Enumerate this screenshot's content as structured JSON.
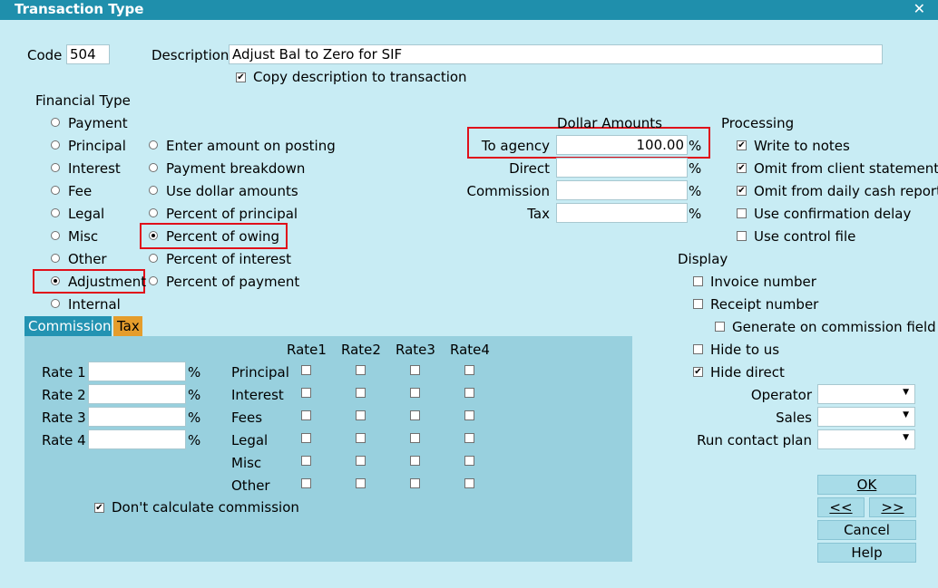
{
  "window": {
    "title": "Transaction Type",
    "close_glyph": "✕"
  },
  "code": {
    "label": "Code",
    "value": "504"
  },
  "description": {
    "label": "Description",
    "value": "Adjust Bal to Zero for SIF"
  },
  "copy_description": {
    "label": "Copy description to transaction",
    "checked": true
  },
  "financial_type": {
    "label": "Financial Type",
    "col1": [
      {
        "label": "Payment",
        "selected": false
      },
      {
        "label": "Principal",
        "selected": false
      },
      {
        "label": "Interest",
        "selected": false
      },
      {
        "label": "Fee",
        "selected": false
      },
      {
        "label": "Legal",
        "selected": false
      },
      {
        "label": "Misc",
        "selected": false
      },
      {
        "label": "Other",
        "selected": false
      },
      {
        "label": "Adjustment",
        "selected": true
      },
      {
        "label": "Internal",
        "selected": false
      }
    ],
    "col2": [
      {
        "label": "Enter amount on posting",
        "selected": false
      },
      {
        "label": "Payment breakdown",
        "selected": false
      },
      {
        "label": "Use dollar amounts",
        "selected": false
      },
      {
        "label": "Percent of principal",
        "selected": false
      },
      {
        "label": "Percent of owing",
        "selected": true
      },
      {
        "label": "Percent of interest",
        "selected": false
      },
      {
        "label": "Percent of payment",
        "selected": false
      }
    ]
  },
  "dollar_amounts": {
    "label": "Dollar Amounts",
    "rows": [
      {
        "label": "To agency",
        "value": "100.00",
        "unit": "%"
      },
      {
        "label": "Direct",
        "value": "",
        "unit": "%"
      },
      {
        "label": "Commission",
        "value": "",
        "unit": "%"
      },
      {
        "label": "Tax",
        "value": "",
        "unit": "%"
      }
    ]
  },
  "processing": {
    "label": "Processing",
    "items": [
      {
        "label": "Write to notes",
        "checked": true
      },
      {
        "label": "Omit from client statement",
        "checked": true
      },
      {
        "label": "Omit from daily cash report",
        "checked": true
      },
      {
        "label": "Use confirmation delay",
        "checked": false
      },
      {
        "label": "Use control file",
        "checked": false
      }
    ]
  },
  "display": {
    "label": "Display",
    "items": [
      {
        "label": "Invoice number",
        "checked": false
      },
      {
        "label": "Receipt number",
        "checked": false
      },
      {
        "label": "Generate on commission field",
        "checked": false
      },
      {
        "label": "Hide to us",
        "checked": false
      },
      {
        "label": "Hide direct",
        "checked": true
      }
    ]
  },
  "selects": [
    {
      "label": "Operator",
      "value": ""
    },
    {
      "label": "Sales",
      "value": ""
    },
    {
      "label": "Run contact plan",
      "value": ""
    }
  ],
  "tabs": {
    "commission": "Commission",
    "tax": "Tax"
  },
  "commission_panel": {
    "rates": [
      {
        "label": "Rate 1",
        "value": "",
        "unit": "%"
      },
      {
        "label": "Rate 2",
        "value": "",
        "unit": "%"
      },
      {
        "label": "Rate 3",
        "value": "",
        "unit": "%"
      },
      {
        "label": "Rate 4",
        "value": "",
        "unit": "%"
      }
    ],
    "grid_headers": [
      "Rate1",
      "Rate2",
      "Rate3",
      "Rate4"
    ],
    "grid_rows": [
      "Principal",
      "Interest",
      "Fees",
      "Legal",
      "Misc",
      "Other"
    ],
    "dont_calculate": {
      "label": "Don't calculate commission",
      "checked": true
    }
  },
  "buttons": {
    "ok": "OK",
    "prev": "<<",
    "next": ">>",
    "cancel": "Cancel",
    "help": "Help"
  },
  "colors": {
    "title_bar": "#1f8fac",
    "background": "#c8ecf4",
    "panel": "#98d0de",
    "tab_active": "#2393b2",
    "tab_tax": "#e59d2c",
    "highlight_box": "#e0101a"
  }
}
